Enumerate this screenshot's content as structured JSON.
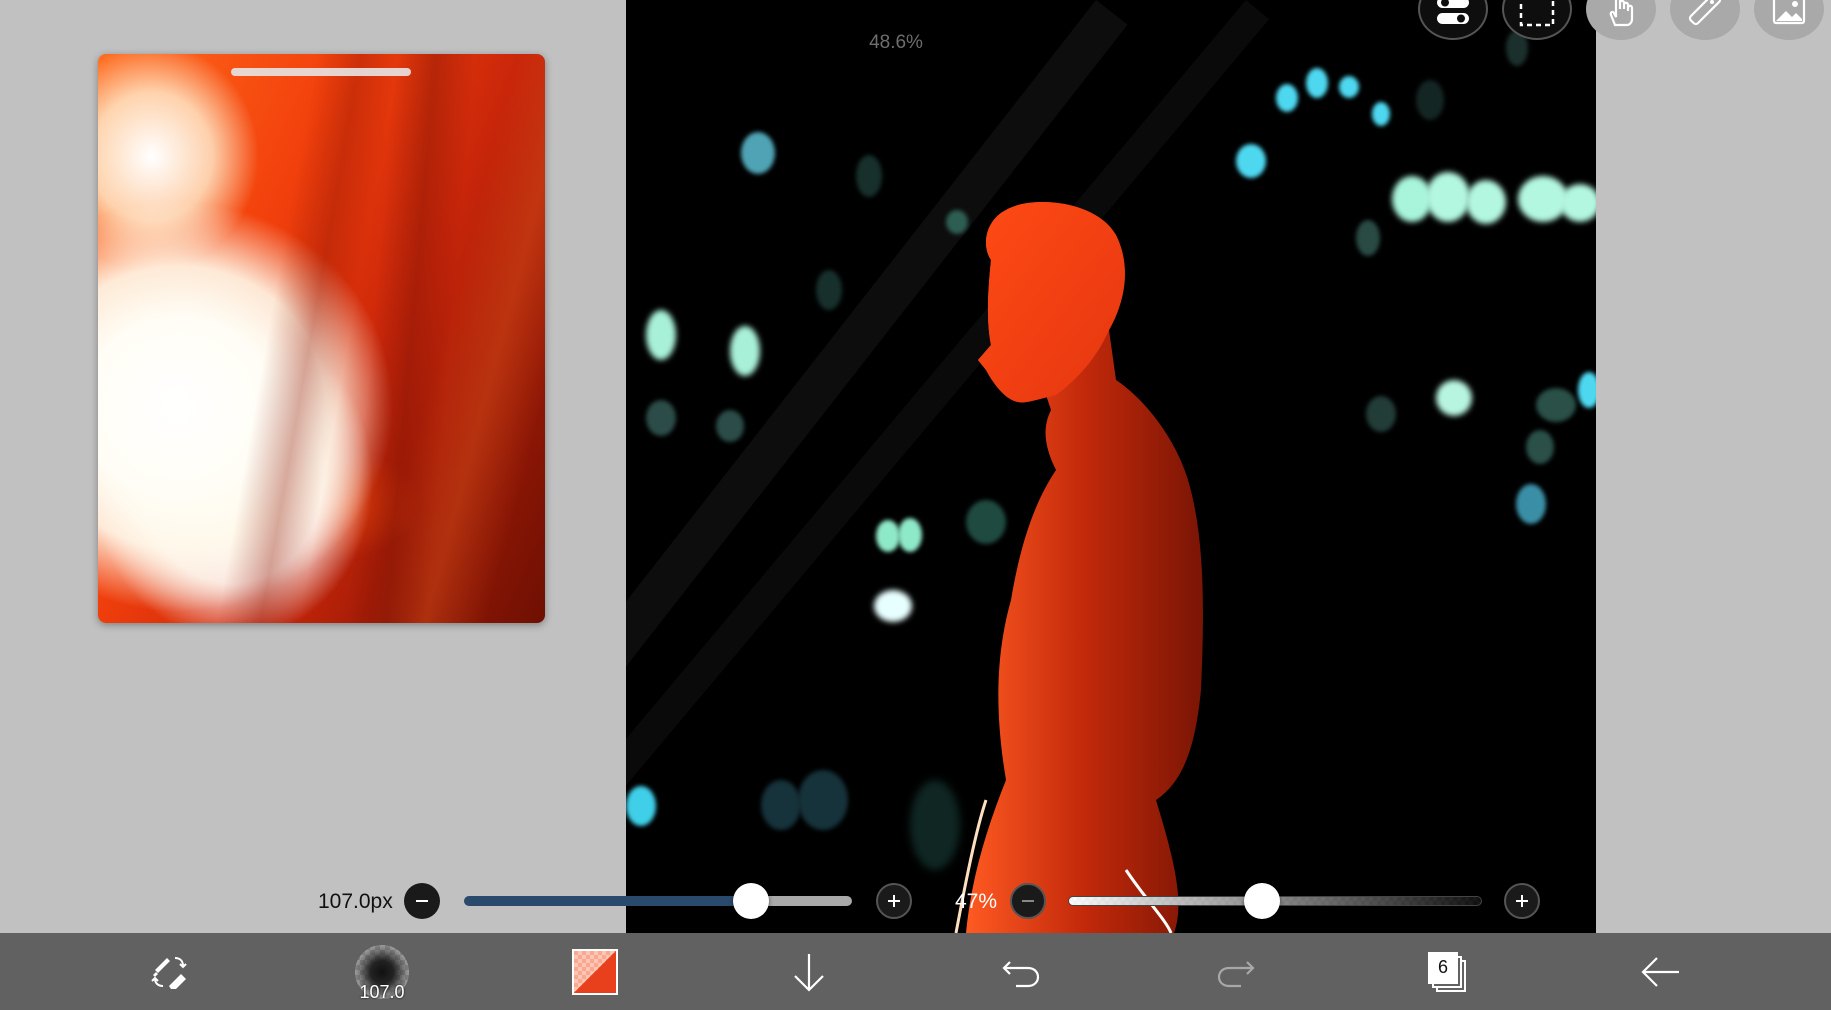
{
  "canvas": {
    "zoom_label": "48.6%"
  },
  "reference_panel": {
    "handle": "drag-handle"
  },
  "top_tools": [
    {
      "name": "toggle-icon"
    },
    {
      "name": "selection-icon"
    },
    {
      "name": "hand-icon"
    },
    {
      "name": "ruler-icon"
    },
    {
      "name": "image-icon"
    }
  ],
  "brush_size_slider": {
    "label": "107.0px",
    "value_fraction": 0.74
  },
  "opacity_slider": {
    "label": "47%",
    "value_fraction": 0.47
  },
  "bottom_toolbar": {
    "tool_icon": "pen-eraser-swap-icon",
    "brush_size": "107.0",
    "primary_color": "#e8401c",
    "layer_count": "6",
    "icons": [
      "down-arrow-icon",
      "undo-icon",
      "redo-icon",
      "layers-icon",
      "back-arrow-icon"
    ]
  },
  "colors": {
    "workspace": "#c1c1c1",
    "toolbar": "#616161",
    "slider_fill": "#2a4a6d",
    "figure": "#e8401c"
  }
}
